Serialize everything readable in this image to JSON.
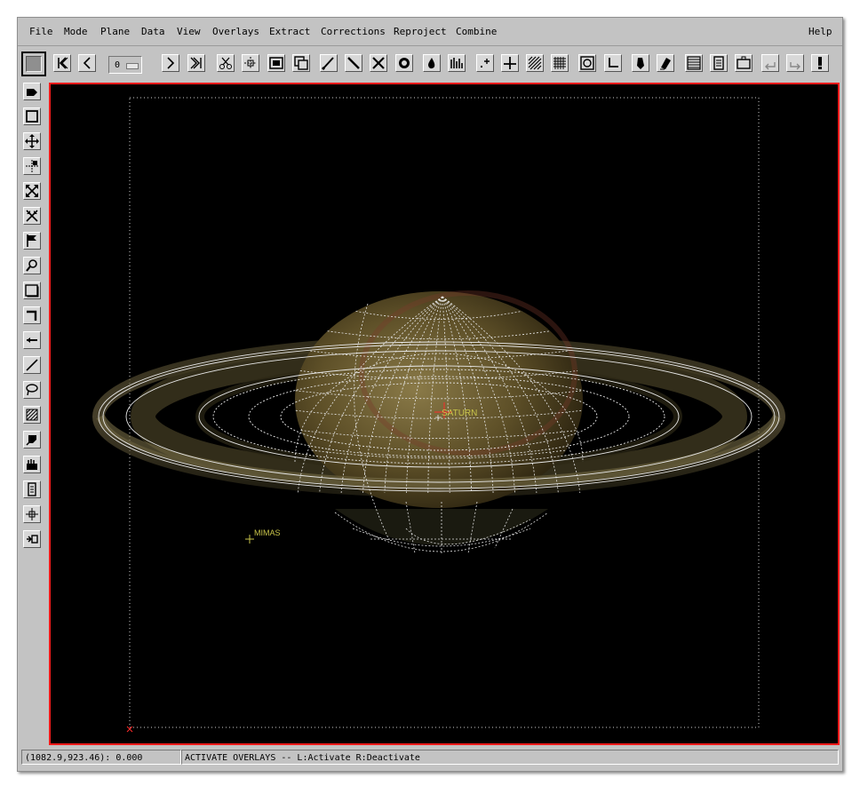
{
  "menu": {
    "items": [
      "File",
      "Mode",
      "Plane",
      "Data",
      "View",
      "Overlays",
      "Extract",
      "Corrections",
      "Reproject",
      "Combine"
    ],
    "help": "Help"
  },
  "toolbar": {
    "plane_value": "0",
    "icons": [
      "first-icon",
      "previous-icon",
      "next-icon",
      "last-icon",
      "cut-icon",
      "crosshair-icon",
      "frame-icon",
      "copy-plane-icon",
      "draw-line-icon",
      "slash-icon",
      "cross-out-icon",
      "circle-icon",
      "drop-icon",
      "histogram-icon",
      "point-icon",
      "axes-icon",
      "hatch-icon",
      "grid-icon",
      "target-icon",
      "corner-icon",
      "pencil-icon",
      "eraser-icon",
      "table-icon",
      "page-icon",
      "window-icon",
      "undo-icon",
      "redo-icon",
      "alert-icon"
    ]
  },
  "side_tools": [
    "pointer-icon",
    "rectangle-icon",
    "move-icon",
    "stretch-icon",
    "expand-icon",
    "shrink-icon",
    "flag-icon",
    "magnify-icon",
    "frame-icon",
    "corner-icon",
    "arrow-icon",
    "line-icon",
    "lasso-icon",
    "fill-icon",
    "paint-icon",
    "stamp-icon",
    "clipboard-icon",
    "center-icon",
    "export-icon"
  ],
  "overlays": {
    "planet_label": "SATURN",
    "moon_label": "MIMAS"
  },
  "colors": {
    "viewport_border": "#ff1a1a",
    "overlay_text": "#c8c44a",
    "grid_lines": "#e8e8e8",
    "planet_body": "#6a5a2e"
  },
  "status": {
    "coords": "(1082.9,923.46): 0.000",
    "message": "ACTIVATE OVERLAYS -- L:Activate R:Deactivate"
  }
}
